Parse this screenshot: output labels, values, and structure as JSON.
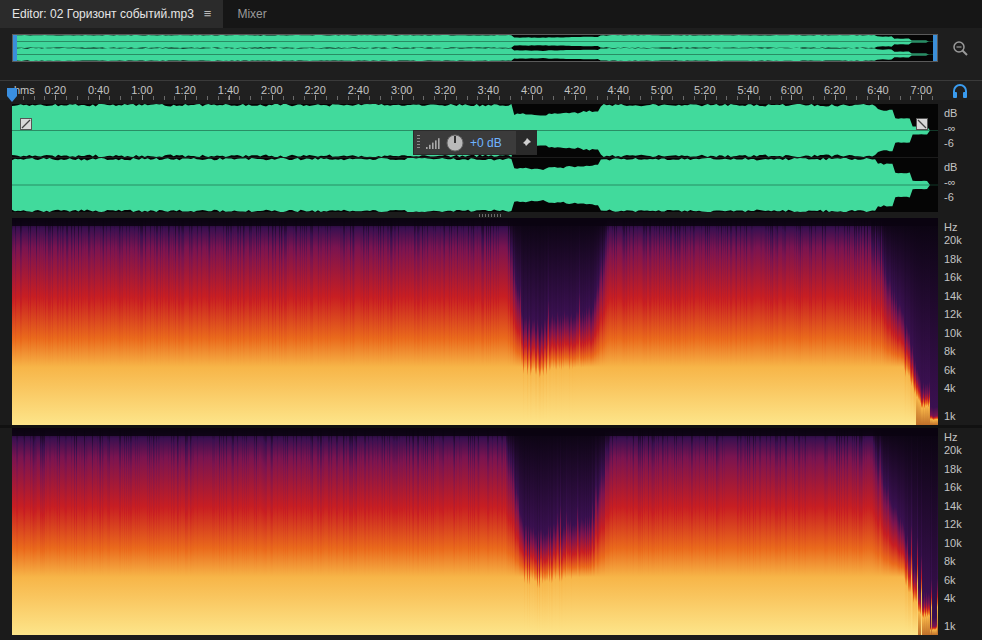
{
  "tabs": [
    {
      "label": "Editor: 02 Горизонт событий.mp3",
      "menu": "≡",
      "selected": true
    },
    {
      "label": "Mixer",
      "selected": false
    }
  ],
  "ruler": {
    "unit": "hms",
    "ticks": [
      {
        "label": "0:20",
        "value": 20
      },
      {
        "label": "0:40",
        "value": 40
      },
      {
        "label": "1:00",
        "value": 60
      },
      {
        "label": "1:20",
        "value": 80
      },
      {
        "label": "1:40",
        "value": 100
      },
      {
        "label": "2:00",
        "value": 120
      },
      {
        "label": "2:20",
        "value": 140
      },
      {
        "label": "2:40",
        "value": 160
      },
      {
        "label": "3:00",
        "value": 180
      },
      {
        "label": "3:20",
        "value": 200
      },
      {
        "label": "3:40",
        "value": 220
      },
      {
        "label": "4:00",
        "value": 240
      },
      {
        "label": "4:20",
        "value": 260
      },
      {
        "label": "4:40",
        "value": 280
      },
      {
        "label": "5:00",
        "value": 300
      },
      {
        "label": "5:20",
        "value": 320
      },
      {
        "label": "5:40",
        "value": 340
      },
      {
        "label": "6:00",
        "value": 360
      },
      {
        "label": "6:20",
        "value": 380
      },
      {
        "label": "6:40",
        "value": 400
      },
      {
        "label": "7:00",
        "value": 420
      }
    ]
  },
  "playhead": {
    "level": 0
  },
  "gain_hud": {
    "reading": "+0 dB"
  },
  "waveform": {
    "channels": [
      {
        "scale": [
          "dB",
          "-∞",
          "-6"
        ]
      },
      {
        "scale": [
          "dB",
          "-∞",
          "-6"
        ]
      }
    ],
    "envelope": [
      0.95,
      0.97,
      0.96,
      0.97,
      0.95,
      0.97,
      0.96,
      0.97,
      0.96,
      0.95,
      0.97,
      0.96,
      0.97,
      0.96,
      0.95,
      0.97,
      0.96,
      0.97,
      0.95,
      0.96,
      0.97,
      0.96,
      0.95,
      0.97,
      0.96,
      0.97,
      0.96,
      0.95,
      0.97,
      0.62,
      0.58,
      0.64,
      0.68,
      0.72,
      0.95,
      0.97,
      0.96,
      0.97,
      0.95,
      0.96,
      0.97,
      0.96,
      0.97,
      0.95,
      0.96,
      0.97,
      0.96,
      0.95,
      0.97,
      0.96,
      0.78,
      0.45,
      0.15
    ]
  },
  "spectrogram": {
    "channels": [
      {
        "unit": "Hz",
        "ticks": [
          {
            "label": "20k",
            "value": 20000
          },
          {
            "label": "18k",
            "value": 18000
          },
          {
            "label": "16k",
            "value": 16000
          },
          {
            "label": "14k",
            "value": 14000
          },
          {
            "label": "12k",
            "value": 12000
          },
          {
            "label": "10k",
            "value": 10000
          },
          {
            "label": "8k",
            "value": 8000
          },
          {
            "label": "6k",
            "value": 6000
          },
          {
            "label": "4k",
            "value": 4000
          },
          {
            "label": "1k",
            "value": 1000
          }
        ]
      },
      {
        "unit": "Hz",
        "ticks": [
          {
            "label": "20k",
            "value": 20000
          },
          {
            "label": "18k",
            "value": 18000
          },
          {
            "label": "16k",
            "value": 16000
          },
          {
            "label": "14k",
            "value": 14000
          },
          {
            "label": "12k",
            "value": 12000
          },
          {
            "label": "10k",
            "value": 10000
          },
          {
            "label": "8k",
            "value": 8000
          },
          {
            "label": "6k",
            "value": 6000
          },
          {
            "label": "4k",
            "value": 4000
          },
          {
            "label": "1k",
            "value": 1000
          }
        ]
      }
    ],
    "levels": [
      1,
      0.98,
      1,
      0.97,
      1,
      0.99,
      1,
      0.98,
      1,
      0.97,
      1,
      0.99,
      1,
      0.98,
      1,
      0.97,
      1,
      0.99,
      1,
      0.98,
      1,
      0.97,
      1,
      0.99,
      1,
      0.98,
      1,
      0.97,
      1,
      0.3,
      0.28,
      0.32,
      0.34,
      0.36,
      0.98,
      1,
      0.97,
      1,
      0.99,
      1,
      0.98,
      1,
      0.97,
      1,
      0.99,
      1,
      0.98,
      1,
      0.97,
      0.95,
      0.6,
      0.3,
      0.1
    ]
  }
}
